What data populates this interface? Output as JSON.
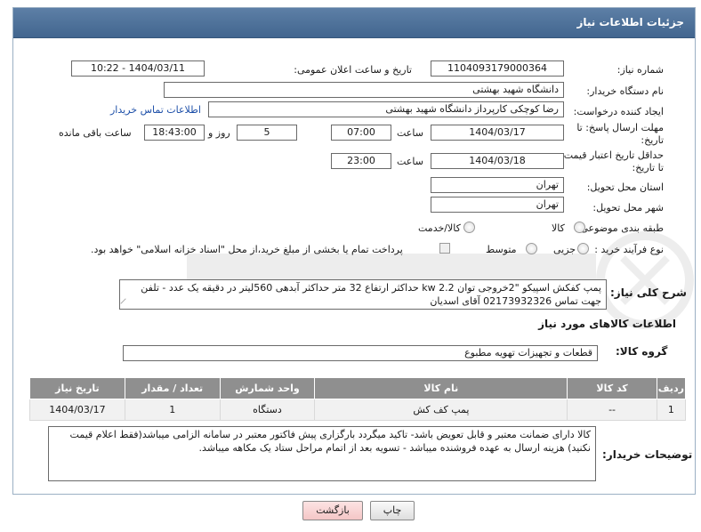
{
  "panel": {
    "title": "جزئیات اطلاعات نیاز"
  },
  "fields": {
    "need_number_label": "شماره نیاز:",
    "need_number": "1104093179000364",
    "announce_datetime_label": "تاریخ و ساعت اعلان عمومی:",
    "announce_datetime": "1404/03/11 - 10:22",
    "buyer_org_label": "نام دستگاه خریدار:",
    "buyer_org": "دانشگاه شهید بهشتی",
    "requester_label": "ایجاد کننده درخواست:",
    "requester": "رضا کوچکی کارپرداز دانشگاه شهید بهشتی",
    "buyer_contact_link": "اطلاعات تماس خریدار",
    "reply_deadline_label_line1": "مهلت ارسال پاسخ: تا",
    "reply_deadline_label_line2": "تاریخ:",
    "reply_date": "1404/03/17",
    "time_label": "ساعت",
    "reply_time": "07:00",
    "days_count": "5",
    "days_label": "روز و",
    "remaining_time": "18:43:00",
    "remaining_label": "ساعت باقی مانده",
    "validity_label_line1": "حداقل تاریخ اعتبار قیمت:",
    "validity_label_line2": "تا تاریخ:",
    "validity_date": "1404/03/18",
    "validity_time": "23:00",
    "province_label": "استان محل تحویل:",
    "province": "تهران",
    "city_label": "شهر محل تحویل:",
    "city": "تهران",
    "category_label": "طبقه بندی موضوعی:",
    "category_options": [
      "کالا",
      "کالا/خدمت"
    ],
    "process_label": "نوع فرآیند خرید :",
    "process_options": [
      "جزیی",
      "متوسط"
    ],
    "payment_note": "پرداخت تمام یا بخشی از مبلغ خرید،از محل \"اسناد خزانه اسلامی\" خواهد بود."
  },
  "description": {
    "label": "شرح کلی نیاز:",
    "text": "پمپ کفکش اسپیکو \"2خروجی توان kw 2.2 حداکثر ارتفاع 32 متر حداکثر آبدهی 560لیتر در دقیقه یک عدد - تلفن جهت تماس 02173932326 آقای اسدیان"
  },
  "goods": {
    "section_title": "اطلاعات کالاهای مورد نیاز",
    "group_label": "گروه کالا:",
    "group_value": "قطعات و تجهیزات تهویه مطبوع",
    "columns": [
      "ردیف",
      "کد کالا",
      "نام کالا",
      "واحد شمارش",
      "تعداد / مقدار",
      "تاریخ نیاز"
    ],
    "rows": [
      {
        "row": "1",
        "code": "--",
        "name": "پمپ کف کش",
        "unit": "دستگاه",
        "qty": "1",
        "date": "1404/03/17"
      }
    ]
  },
  "buyer_notes": {
    "label": "توضیحات خریدار:",
    "text": "کالا دارای ضمانت معتبر و قابل تعویض باشد- تاکید میگردد بارگزاری پیش فاکتور معتبر در سامانه الزامی میباشد(فقط اعلام قیمت نکنید) هزینه ارسال به عهده فروشنده میباشد - تسویه بعد از اتمام مراحل ستاد یک مکاهه میباشد."
  },
  "buttons": {
    "print": "چاپ",
    "back": "بازگشت"
  },
  "colors": {
    "header": "#4d729a",
    "table_header": "#8f8f8f",
    "link": "#1d4fa8"
  }
}
